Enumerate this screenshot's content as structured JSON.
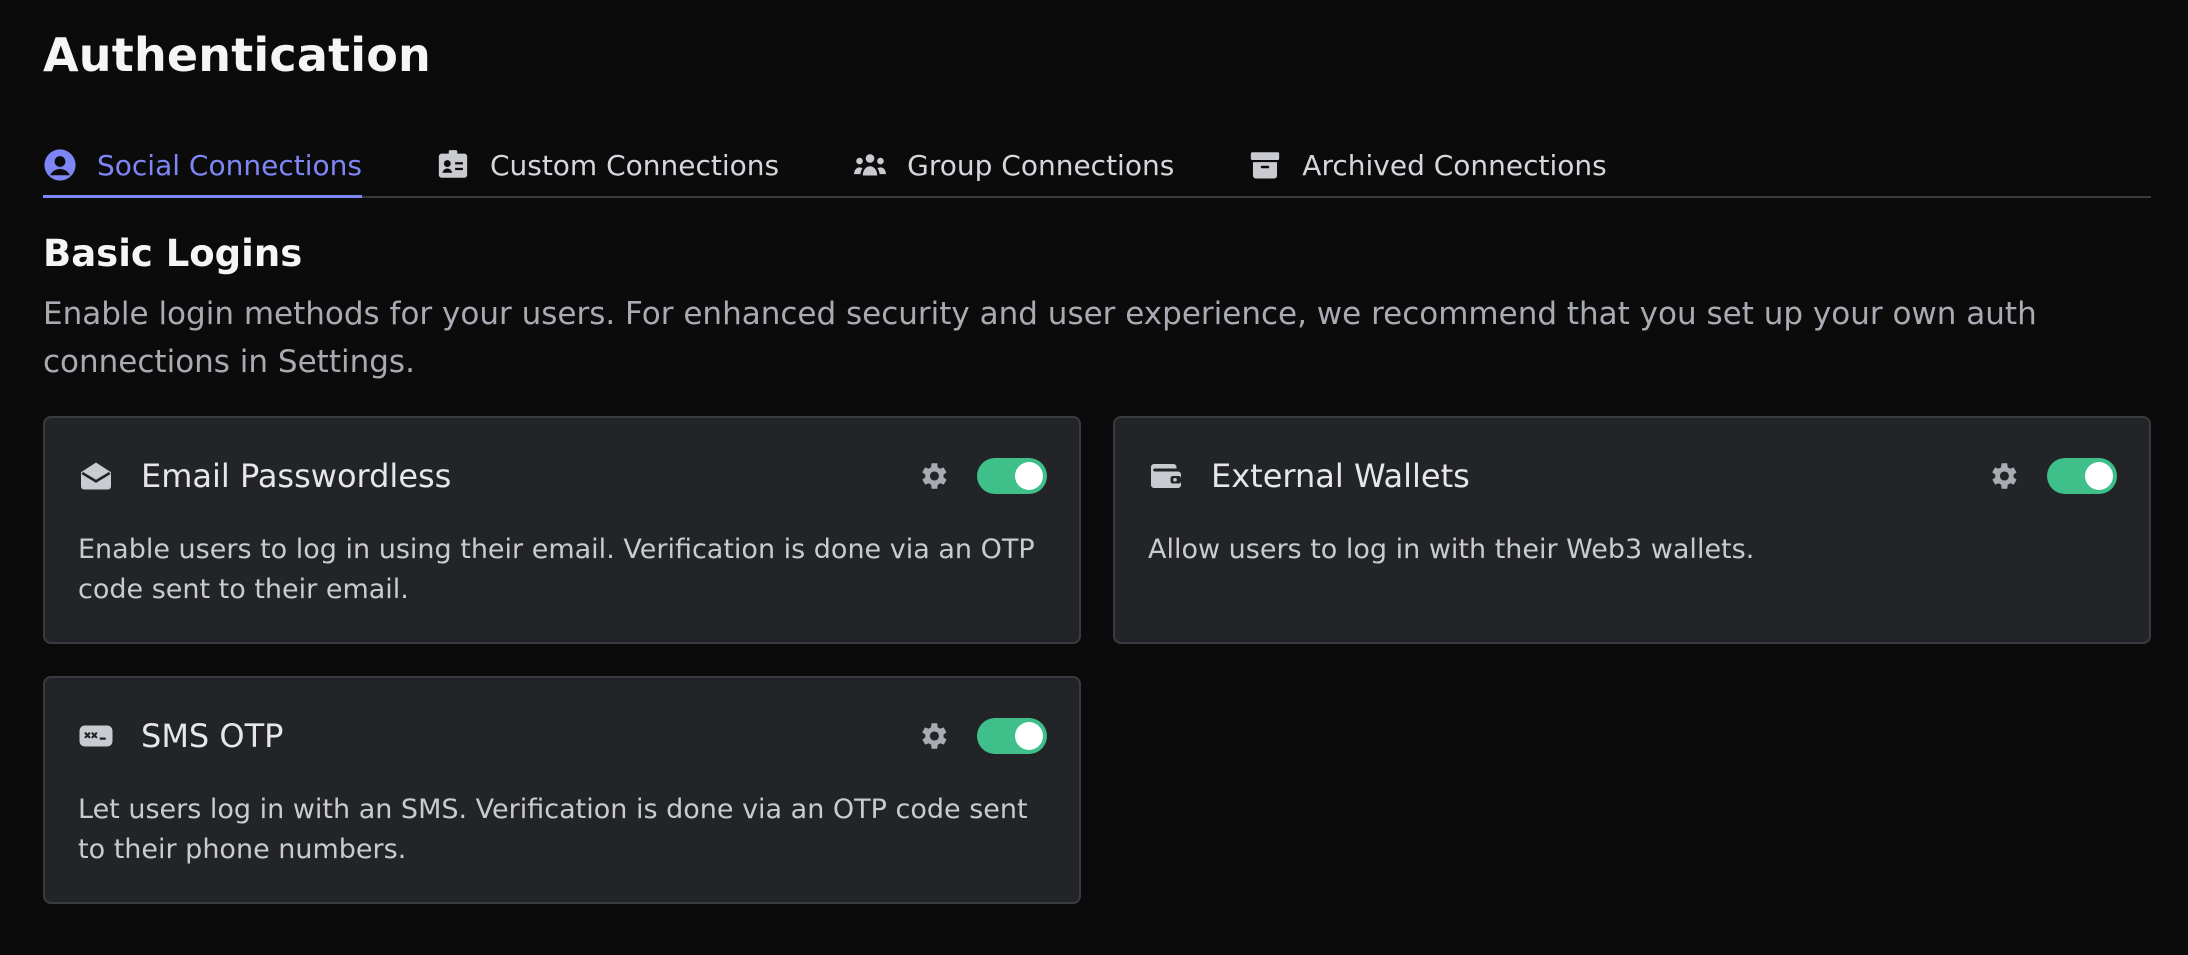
{
  "page": {
    "title": "Authentication"
  },
  "tabs": [
    {
      "label": "Social Connections",
      "icon": "user-circle-icon",
      "active": true
    },
    {
      "label": "Custom Connections",
      "icon": "id-card-icon",
      "active": false
    },
    {
      "label": "Group Connections",
      "icon": "users-icon",
      "active": false
    },
    {
      "label": "Archived Connections",
      "icon": "archive-box-icon",
      "active": false
    }
  ],
  "section": {
    "title": "Basic Logins",
    "description": "Enable login methods for your users. For enhanced security and user experience, we recommend that you set up your own auth connections in Settings."
  },
  "cards": [
    {
      "title": "Email Passwordless",
      "icon": "envelope-open-icon",
      "enabled": true,
      "description": "Enable users to log in using their email. Verification is done via an OTP code sent to their email."
    },
    {
      "title": "External Wallets",
      "icon": "wallet-icon",
      "enabled": true,
      "description": "Allow users to log in with their Web3 wallets."
    },
    {
      "title": "SMS OTP",
      "icon": "sms-otp-icon",
      "enabled": true,
      "description": "Let users log in with an SMS. Verification is done via an OTP code sent to their phone numbers."
    }
  ],
  "colors": {
    "accent": "#7e86f5",
    "toggle_on": "#3fbf8a",
    "background": "#0b0b0c",
    "card": "#232427"
  }
}
